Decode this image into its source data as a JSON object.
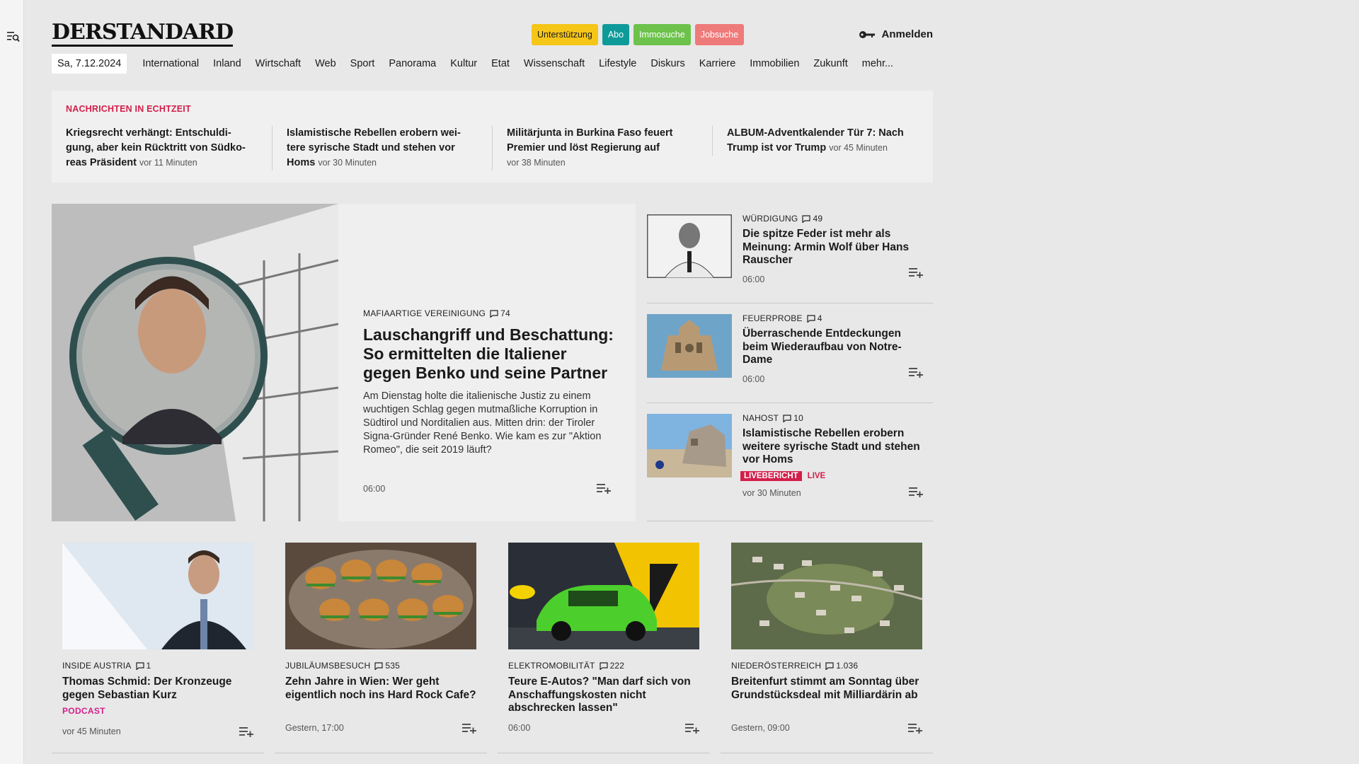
{
  "brand": {
    "logo": "DERSTANDARD"
  },
  "header_pills": [
    {
      "label": "Unterstützung",
      "color": "#f5c518",
      "text_color": "#1a1a1a"
    },
    {
      "label": "Abo",
      "color": "#0f9a9a",
      "text_color": "#ffffff"
    },
    {
      "label": "Immosuche",
      "color": "#6cc24a",
      "text_color": "#ffffff"
    },
    {
      "label": "Jobsuche",
      "color": "#ef7a7a",
      "text_color": "#ffffff"
    }
  ],
  "login": {
    "label": "Anmelden",
    "icon": "key-icon"
  },
  "nav": {
    "date": "Sa, 7.12.2024",
    "items": [
      "International",
      "Inland",
      "Wirtschaft",
      "Web",
      "Sport",
      "Panorama",
      "Kultur",
      "Etat",
      "Wissenschaft",
      "Lifestyle",
      "Diskurs",
      "Karriere",
      "Immobilien",
      "Zukunft",
      "mehr..."
    ]
  },
  "ticker": {
    "label": "NACHRICHTEN IN ECHTZEIT",
    "items": [
      {
        "title": "Kriegsrecht verhängt: Entschuldi-gung, aber kein Rücktritt von Südko-reas Präsident",
        "time": "vor 11 Minuten"
      },
      {
        "title": "Islamistische Rebellen erobern wei-tere syrische Stadt und stehen vor Homs",
        "time": "vor 30 Minuten"
      },
      {
        "title": "Militärjunta in Burkina Faso feuert Premier und löst Regierung auf",
        "time": "vor 38 Minuten"
      },
      {
        "title": "ALBUM-Adventkalender Tür 7: Nach Trump ist vor Trump",
        "time": "vor 45 Minuten"
      }
    ]
  },
  "hero": {
    "kicker": "MAFIAARTIGE VEREINIGUNG",
    "comments": "74",
    "title": "Lauschangriff und Beschattung: So ermittelten die Italiener gegen Benko und seine Partner",
    "teaser": "Am Dienstag holte die italienische Justiz zu einem wuchtigen Schlag gegen mutmaßliche Korruption in Südtirol und Norditalien aus. Mitten drin: der Tiroler Signa-Gründer René Benko. Wie kam es zur \"Aktion Romeo\", die seit 2019 läuft?",
    "time": "06:00"
  },
  "side": [
    {
      "kicker": "WÜRDIGUNG",
      "comments": "49",
      "title": "Die spitze Feder ist mehr als Meinung: Armin Wolf über Hans Rauscher",
      "time": "06:00"
    },
    {
      "kicker": "FEUERPROBE",
      "comments": "4",
      "title": "Überraschende Entdeckungen beim Wiederaufbau von Notre-Dame",
      "time": "06:00"
    },
    {
      "kicker": "NAHOST",
      "comments": "10",
      "title": "Islamistische Rebellen erobern weitere syrische Stadt und stehen vor Homs",
      "badge": "LIVEBERICHT",
      "badge2": "LIVE",
      "time": "vor 30 Minuten"
    }
  ],
  "cards": [
    {
      "kicker": "INSIDE AUSTRIA",
      "comments": "1",
      "title": "Thomas Schmid: Der Kronzeuge gegen Sebastian Kurz",
      "tag": "PODCAST",
      "time": "vor 45 Minuten"
    },
    {
      "kicker": "JUBILÄUMSBESUCH",
      "comments": "535",
      "title": "Zehn Jahre in Wien: Wer geht eigentlich noch ins Hard Rock Cafe?",
      "time": "Gestern, 17:00"
    },
    {
      "kicker": "ELEKTROMOBILITÄT",
      "comments": "222",
      "title": "Teure E-Autos? \"Man darf sich von Anschaffungskosten nicht abschrecken lassen\"",
      "time": "06:00"
    },
    {
      "kicker": "NIEDERÖSTERREICH",
      "comments": "1.036",
      "title": "Breitenfurt stimmt am Sonntag über Grundstücksdeal mit Milliardärin ab",
      "time": "Gestern, 09:00"
    }
  ]
}
